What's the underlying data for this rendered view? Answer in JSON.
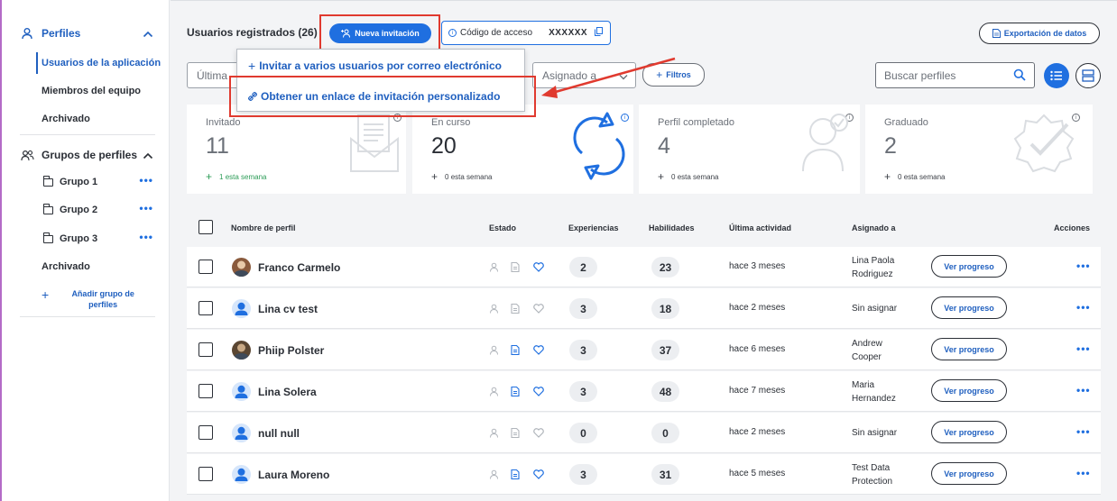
{
  "sidebar": {
    "profiles_label": "Perfiles",
    "items": [
      {
        "label": "Usuarios de la aplicación",
        "active": true
      },
      {
        "label": "Miembros del equipo"
      },
      {
        "label": "Archivado"
      }
    ],
    "groups_label": "Grupos de perfiles",
    "groups": [
      {
        "label": "Grupo 1",
        "more": "•••"
      },
      {
        "label": "Grupo 2",
        "more": "•••"
      },
      {
        "label": "Grupo 3",
        "more": "•••"
      }
    ],
    "groups_archived": "Archivado",
    "add_group": "Añadir grupo de perfiles"
  },
  "header": {
    "title": "Usuarios registrados (26)",
    "new_invite": "Nueva invitación",
    "access_code_label": "Código de acceso",
    "access_code": "XXXXXX",
    "export": "Exportación de datos"
  },
  "filters": {
    "last_placeholder": "Última",
    "assigned_placeholder": "Asignado a",
    "filters_button": "Filtros",
    "search_placeholder": "Buscar perfiles"
  },
  "menu": {
    "invite_email": "Invitar a varios usuarios por correo electrónico",
    "invite_link": "Obtener un enlace de invitación personalizado"
  },
  "stats": [
    {
      "label": "Invitado",
      "value": "11",
      "sub": "1 esta semana",
      "info": "i"
    },
    {
      "label": "En curso",
      "value": "20",
      "sub": "0 esta semana",
      "info": "i"
    },
    {
      "label": "Perfil completado",
      "value": "4",
      "sub": "0 esta semana",
      "info": "i"
    },
    {
      "label": "Graduado",
      "value": "2",
      "sub": "0 esta semana",
      "info": "i"
    }
  ],
  "table": {
    "headers": {
      "name": "Nombre de perfil",
      "status": "Estado",
      "experiences": "Experiencias",
      "skills": "Habilidades",
      "activity": "Última actividad",
      "assigned": "Asignado a",
      "actions": "Acciones"
    },
    "view_progress": "Ver progreso",
    "more": "•••",
    "rows": [
      {
        "name": "Franco Carmelo",
        "exp": "2",
        "skills": "23",
        "activity": "hace 3 meses",
        "assigned1": "Lina Paola",
        "assigned2": "Rodriguez"
      },
      {
        "name": "Lina cv test",
        "exp": "3",
        "skills": "18",
        "activity": "hace 2 meses",
        "assigned1": "Sin asignar",
        "assigned2": ""
      },
      {
        "name": "Phiip Polster",
        "exp": "3",
        "skills": "37",
        "activity": "hace 6 meses",
        "assigned1": "Andrew",
        "assigned2": "Cooper"
      },
      {
        "name": "Lina Solera",
        "exp": "3",
        "skills": "48",
        "activity": "hace 7 meses",
        "assigned1": "Maria",
        "assigned2": "Hernandez"
      },
      {
        "name": "null null",
        "exp": "0",
        "skills": "0",
        "activity": "hace 2 meses",
        "assigned1": "Sin asignar",
        "assigned2": ""
      },
      {
        "name": "Laura Moreno",
        "exp": "3",
        "skills": "31",
        "activity": "hace 5 meses",
        "assigned1": "Test Data",
        "assigned2": "Protection"
      }
    ]
  },
  "colors": {
    "accent": "#1f6fe0",
    "annotation": "#e03a2f",
    "success": "#2c9c57"
  }
}
